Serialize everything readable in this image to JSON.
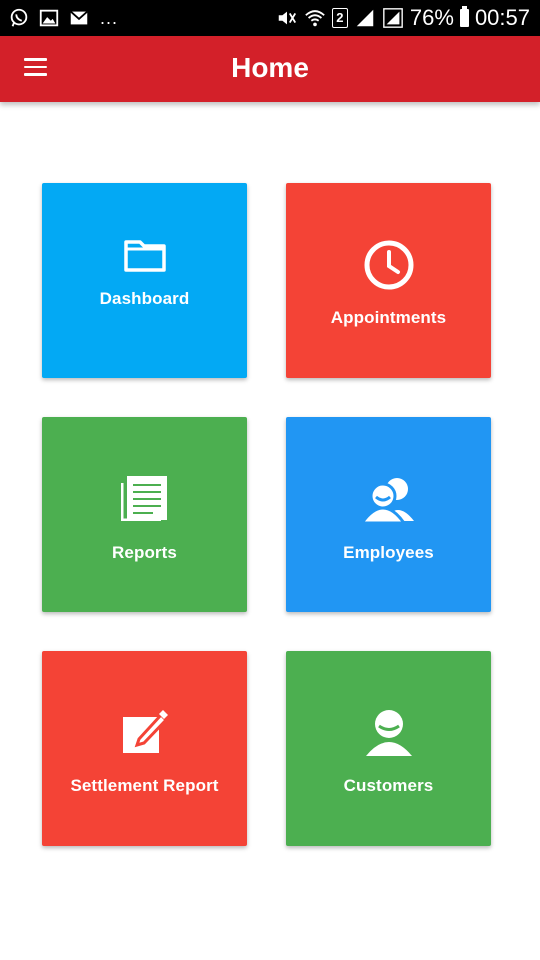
{
  "status_bar": {
    "left_icons": [
      "whatsapp-icon",
      "image-icon",
      "mail-icon"
    ],
    "more": "...",
    "sim_slot": "2",
    "battery_percent": "76%",
    "time": "00:57"
  },
  "app_bar": {
    "title": "Home",
    "menu_icon": "hamburger-menu-icon",
    "color": "#d32029"
  },
  "tiles": [
    {
      "label": "Dashboard",
      "icon": "folder-icon",
      "color": "#03a9f4"
    },
    {
      "label": "Appointments",
      "icon": "clock-icon",
      "color": "#f44336"
    },
    {
      "label": "Reports",
      "icon": "document-icon",
      "color": "#4caf50"
    },
    {
      "label": "Employees",
      "icon": "people-icon",
      "color": "#2196f3"
    },
    {
      "label": "Settlement Report",
      "icon": "edit-icon",
      "color": "#f44336"
    },
    {
      "label": "Customers",
      "icon": "person-icon",
      "color": "#4caf50"
    }
  ]
}
